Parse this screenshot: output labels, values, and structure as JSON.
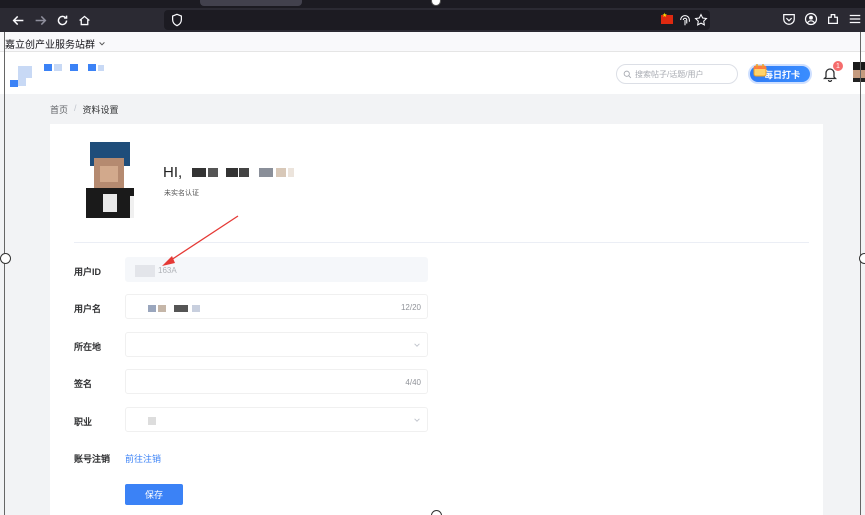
{
  "browser": {
    "bookmark_folder": "嘉立创产业服务站群",
    "icons": [
      "back-icon",
      "forward-icon",
      "reload-icon",
      "home-icon",
      "shield-icon",
      "flag-icon",
      "fingerprint-icon",
      "bookmark-star-icon",
      "pocket-icon",
      "account-icon",
      "extensions-icon",
      "menu-icon"
    ]
  },
  "header": {
    "search_placeholder": "搜索帖子/话题/用户",
    "checkin_label": "每日打卡",
    "notification_count": "1"
  },
  "breadcrumb": {
    "home": "首页",
    "separator": "/",
    "current": "资料设置"
  },
  "profile": {
    "greeting": "HI,",
    "verify_status": "未实名认证"
  },
  "form": {
    "user_id_label": "用户ID",
    "user_id_value": "163A",
    "username_label": "用户名",
    "username_count": "12/20",
    "location_label": "所在地",
    "signature_label": "签名",
    "signature_count": "4/40",
    "job_label": "职业",
    "account_cancel_label": "账号注销",
    "account_cancel_link": "前往注销",
    "save_label": "保存"
  },
  "colors": {
    "accent": "#3b82f6",
    "badge": "#f56c6c",
    "annotation_arrow": "#e53935"
  }
}
